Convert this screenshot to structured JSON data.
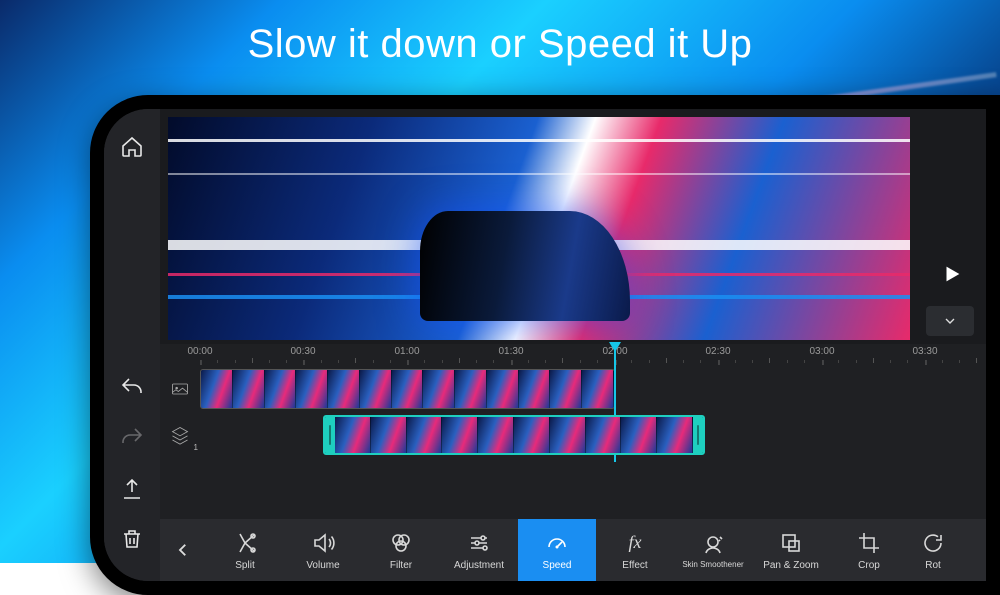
{
  "headline": "Slow it down or Speed it Up",
  "leftToolbar": {
    "home": "home",
    "undo": "undo",
    "redo": "redo",
    "export": "export",
    "delete": "delete"
  },
  "ruler": {
    "marks": [
      "00:00",
      "00:30",
      "01:00",
      "01:30",
      "02:00",
      "02:30",
      "03:00",
      "03:30"
    ]
  },
  "tracks": {
    "track1_icon": "media",
    "track2_icon": "layers",
    "track2_badge": "1"
  },
  "tools": [
    {
      "key": "split",
      "label": "Split"
    },
    {
      "key": "volume",
      "label": "Volume"
    },
    {
      "key": "filter",
      "label": "Filter"
    },
    {
      "key": "adjustment",
      "label": "Adjustment"
    },
    {
      "key": "speed",
      "label": "Speed",
      "active": true
    },
    {
      "key": "effect",
      "label": "Effect"
    },
    {
      "key": "skin",
      "label": "Skin Smoothener"
    },
    {
      "key": "panzoom",
      "label": "Pan & Zoom"
    },
    {
      "key": "crop",
      "label": "Crop"
    },
    {
      "key": "rotate",
      "label": "Rot"
    }
  ]
}
